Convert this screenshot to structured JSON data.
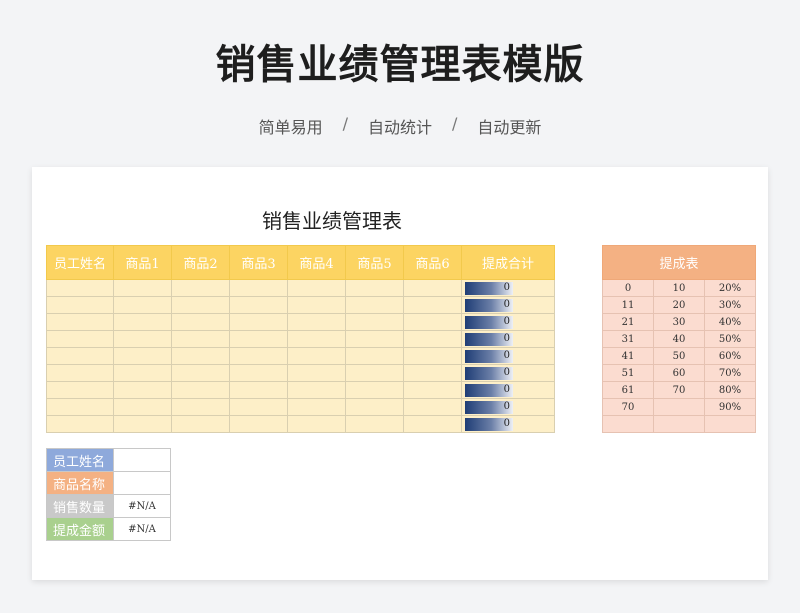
{
  "hero": {
    "title": "销售业绩管理表模版",
    "features": [
      "简单易用",
      "自动统计",
      "自动更新"
    ],
    "separator": "/"
  },
  "sheet": {
    "title": "销售业绩管理表",
    "main_table": {
      "headers": [
        "员工姓名",
        "商品1",
        "商品2",
        "商品3",
        "商品4",
        "商品5",
        "商品6",
        "提成合计"
      ],
      "totals": [
        "0",
        "0",
        "0",
        "0",
        "0",
        "0",
        "0",
        "0",
        "0"
      ],
      "bar_fraction": 0,
      "bar_color": "#1f3d75",
      "header_color": "#fcd462",
      "cell_color": "#fdefc8"
    },
    "rate_table": {
      "header": "提成表",
      "rows": [
        [
          "0",
          "10",
          "20%"
        ],
        [
          "11",
          "20",
          "30%"
        ],
        [
          "21",
          "30",
          "40%"
        ],
        [
          "31",
          "40",
          "50%"
        ],
        [
          "41",
          "50",
          "60%"
        ],
        [
          "51",
          "60",
          "70%"
        ],
        [
          "61",
          "70",
          "80%"
        ],
        [
          "70",
          "",
          "90%"
        ],
        [
          "",
          "",
          ""
        ]
      ],
      "header_color": "#f4b183",
      "cell_color": "#fbdcd0"
    },
    "query_table": {
      "rows": [
        {
          "label": "员工姓名",
          "value": "",
          "color": "#8ea9db"
        },
        {
          "label": "商品名称",
          "value": "",
          "color": "#f4b183"
        },
        {
          "label": "销售数量",
          "value": "#N/A",
          "color": "#c9c9c9"
        },
        {
          "label": "提成金额",
          "value": "#N/A",
          "color": "#a9d08e"
        }
      ]
    }
  }
}
